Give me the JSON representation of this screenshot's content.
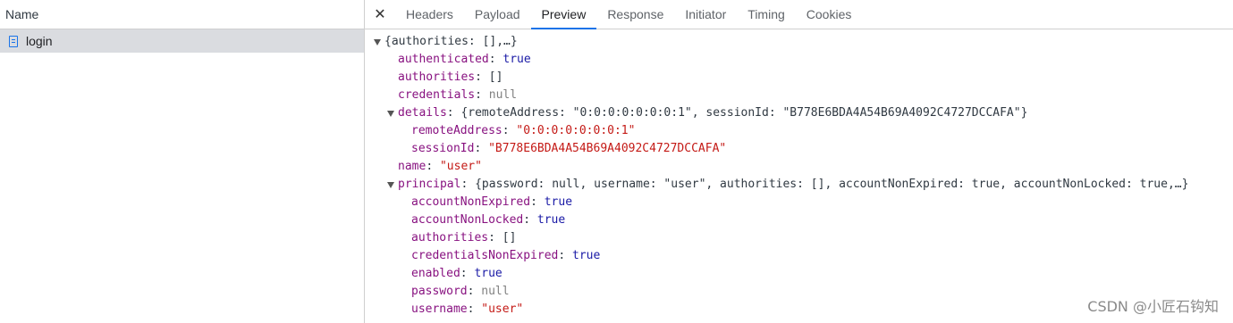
{
  "left_panel": {
    "header": "Name",
    "requests": [
      {
        "name": "login"
      }
    ]
  },
  "tabs": [
    "Headers",
    "Payload",
    "Preview",
    "Response",
    "Initiator",
    "Timing",
    "Cookies"
  ],
  "active_tab": "Preview",
  "close_glyph": "✕",
  "preview": {
    "root_summary": "{authorities: [],…}",
    "authenticated": {
      "key": "authenticated",
      "value": "true"
    },
    "authorities": {
      "key": "authorities",
      "value": "[]"
    },
    "credentials": {
      "key": "credentials",
      "value": "null"
    },
    "details": {
      "key": "details",
      "summary": "{remoteAddress: \"0:0:0:0:0:0:0:1\", sessionId: \"B778E6BDA4A54B69A4092C4727DCCAFA\"}",
      "remoteAddress": {
        "key": "remoteAddress",
        "value": "\"0:0:0:0:0:0:0:1\""
      },
      "sessionId": {
        "key": "sessionId",
        "value": "\"B778E6BDA4A54B69A4092C4727DCCAFA\""
      }
    },
    "name": {
      "key": "name",
      "value": "\"user\""
    },
    "principal": {
      "key": "principal",
      "summary": "{password: null, username: \"user\", authorities: [], accountNonExpired: true, accountNonLocked: true,…}",
      "accountNonExpired": {
        "key": "accountNonExpired",
        "value": "true"
      },
      "accountNonLocked": {
        "key": "accountNonLocked",
        "value": "true"
      },
      "authorities": {
        "key": "authorities",
        "value": "[]"
      },
      "credentialsNonExpired": {
        "key": "credentialsNonExpired",
        "value": "true"
      },
      "enabled": {
        "key": "enabled",
        "value": "true"
      },
      "password": {
        "key": "password",
        "value": "null"
      },
      "username": {
        "key": "username",
        "value": "\"user\""
      }
    }
  },
  "watermark": "CSDN @小匠石钩知",
  "colors": {
    "accent": "#1a73e8",
    "key": "#881280",
    "string": "#c41a16",
    "boolean": "#1a1aa6",
    "null": "#808080"
  }
}
